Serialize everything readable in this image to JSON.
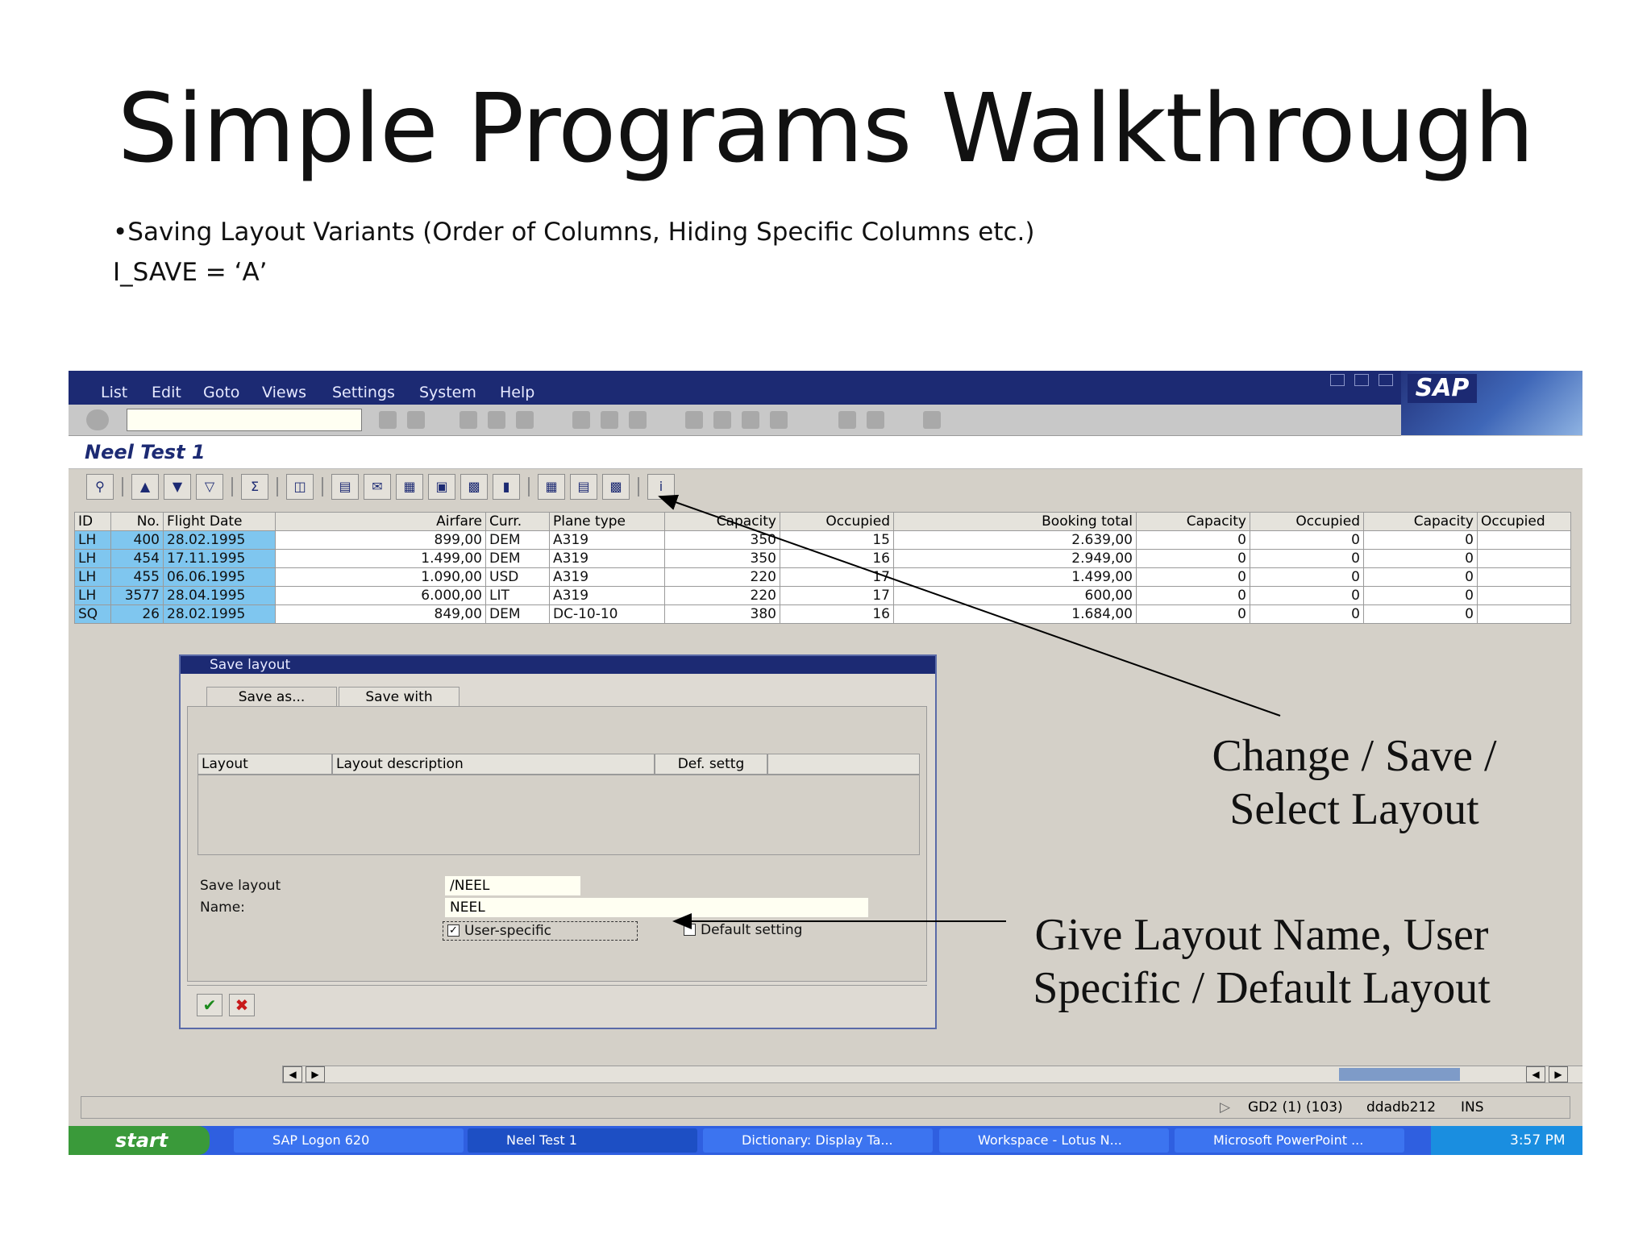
{
  "slide": {
    "title": "Simple Programs Walkthrough",
    "bullet1": "•Saving Layout Variants (Order of Columns, Hiding Specific Columns etc.)",
    "bullet2": "I_SAVE = ‘A’"
  },
  "menu": [
    "List",
    "Edit",
    "Goto",
    "Views",
    "Settings",
    "System",
    "Help"
  ],
  "brand": "SAP",
  "screen_title": "Neel Test 1",
  "grid": {
    "headers": [
      "ID",
      "No.",
      "Flight Date",
      "Airfare",
      "Curr.",
      "Plane type",
      "Capacity",
      "Occupied",
      "Booking total",
      "Capacity",
      "Occupied",
      "Capacity",
      "Occupied"
    ],
    "rows": [
      [
        "LH",
        "400",
        "28.02.1995",
        "899,00",
        "DEM",
        "A319",
        "350",
        "15",
        "2.639,00",
        "0",
        "0",
        "0",
        ""
      ],
      [
        "LH",
        "454",
        "17.11.1995",
        "1.499,00",
        "DEM",
        "A319",
        "350",
        "16",
        "2.949,00",
        "0",
        "0",
        "0",
        ""
      ],
      [
        "LH",
        "455",
        "06.06.1995",
        "1.090,00",
        "USD",
        "A319",
        "220",
        "17",
        "1.499,00",
        "0",
        "0",
        "0",
        ""
      ],
      [
        "LH",
        "3577",
        "28.04.1995",
        "6.000,00",
        "LIT",
        "A319",
        "220",
        "17",
        "600,00",
        "0",
        "0",
        "0",
        ""
      ],
      [
        "SQ",
        "26",
        "28.02.1995",
        "849,00",
        "DEM",
        "DC-10-10",
        "380",
        "16",
        "1.684,00",
        "0",
        "0",
        "0",
        ""
      ]
    ]
  },
  "dialog": {
    "title": "Save layout",
    "tabs": [
      "Save as...",
      "Save with"
    ],
    "list_headers": [
      "Layout",
      "Layout description",
      "Def. settg"
    ],
    "save_layout_label": "Save layout",
    "save_layout_value": "/NEEL",
    "name_label": "Name:",
    "name_value": "NEEL",
    "user_specific_label": "User-specific",
    "user_specific_checked": true,
    "default_setting_label": "Default setting",
    "default_setting_checked": false
  },
  "status": {
    "system": "GD2 (1) (103)",
    "server": "ddadb212",
    "mode": "INS"
  },
  "taskbar": {
    "start": "start",
    "items": [
      "SAP Logon 620",
      "Neel Test 1",
      "Dictionary: Display Ta...",
      "Workspace - Lotus N...",
      "Microsoft PowerPoint ..."
    ],
    "time": "3:57 PM"
  },
  "annotations": {
    "top": "Change / Save / Select Layout",
    "bottom": "Give Layout Name, User Specific / Default Layout"
  }
}
